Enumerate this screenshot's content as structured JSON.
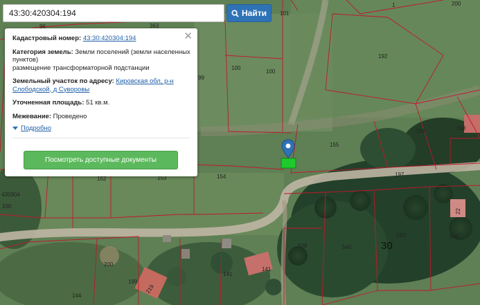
{
  "search": {
    "value": "43:30:420304:194",
    "button_label": "Найти",
    "button_icon": "search-icon"
  },
  "popup": {
    "cadastral_label": "Кадастровый номер:",
    "cadastral_value": "43:30:420304:194",
    "category_label": "Категория земель:",
    "category_value": "Земли поселений (земли населенных пунктов)",
    "category_usage": "размещение трансформаторной подстанции",
    "address_label": "Земельный участок по адресу:",
    "address_line1": "Кировская обл, р-н",
    "address_line2": "Слободской, д Суворовы",
    "area_label": "Уточненная площадь:",
    "area_value": "51 кв.м.",
    "survey_label": "Межевание:",
    "survey_value": "Проведено",
    "details_label": "Подробно",
    "documents_button": "Посмотреть доступные документы",
    "close_icon": "close-icon"
  },
  "map": {
    "plot_labels": [
      "96",
      "363",
      "101",
      "1",
      "192",
      "100",
      "100",
      "99",
      "200",
      "156",
      "158",
      "155",
      "152",
      "153",
      "154",
      "197",
      "420304",
      "150",
      "22",
      "543",
      "542",
      "539",
      "540",
      "30",
      "200",
      "141",
      "141",
      "199",
      "219",
      "144"
    ],
    "quarter_label": "30",
    "marker_icon": "map-pin-icon",
    "parcel_color": "#1ecb2d",
    "boundary_color": "#c0182a",
    "accent_color": "#2f73b7",
    "button_color": "#5cb85c"
  }
}
